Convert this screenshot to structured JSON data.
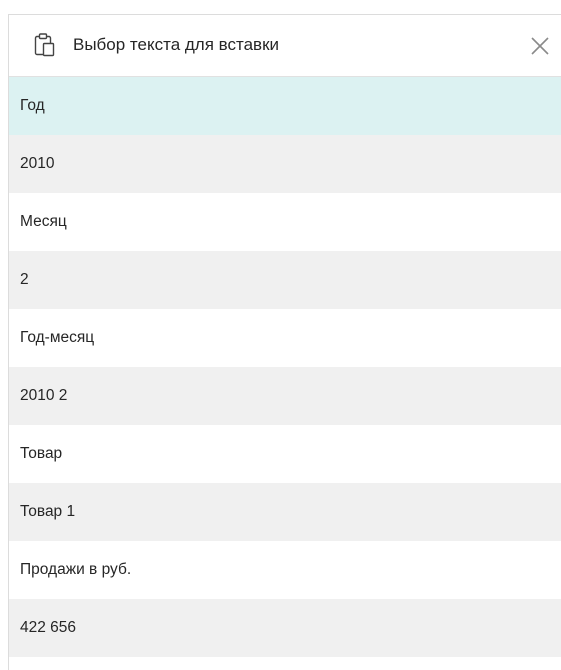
{
  "dialog": {
    "title": "Выбор текста для вставки",
    "icon": "clipboard-icon",
    "close_icon": "close-icon"
  },
  "items": [
    {
      "text": "Год",
      "kind": "label",
      "selected": true
    },
    {
      "text": "2010",
      "kind": "value"
    },
    {
      "text": "Месяц",
      "kind": "label"
    },
    {
      "text": "2",
      "kind": "value"
    },
    {
      "text": "Год-месяц",
      "kind": "label"
    },
    {
      "text": "2010 2",
      "kind": "value"
    },
    {
      "text": "Товар",
      "kind": "label"
    },
    {
      "text": "Товар 1",
      "kind": "value"
    },
    {
      "text": "Продажи в руб.",
      "kind": "label"
    },
    {
      "text": "422 656",
      "kind": "value"
    }
  ],
  "colors": {
    "selected_bg": "#dcf2f2",
    "value_bg": "#f0f0f0",
    "label_bg": "#ffffff"
  }
}
